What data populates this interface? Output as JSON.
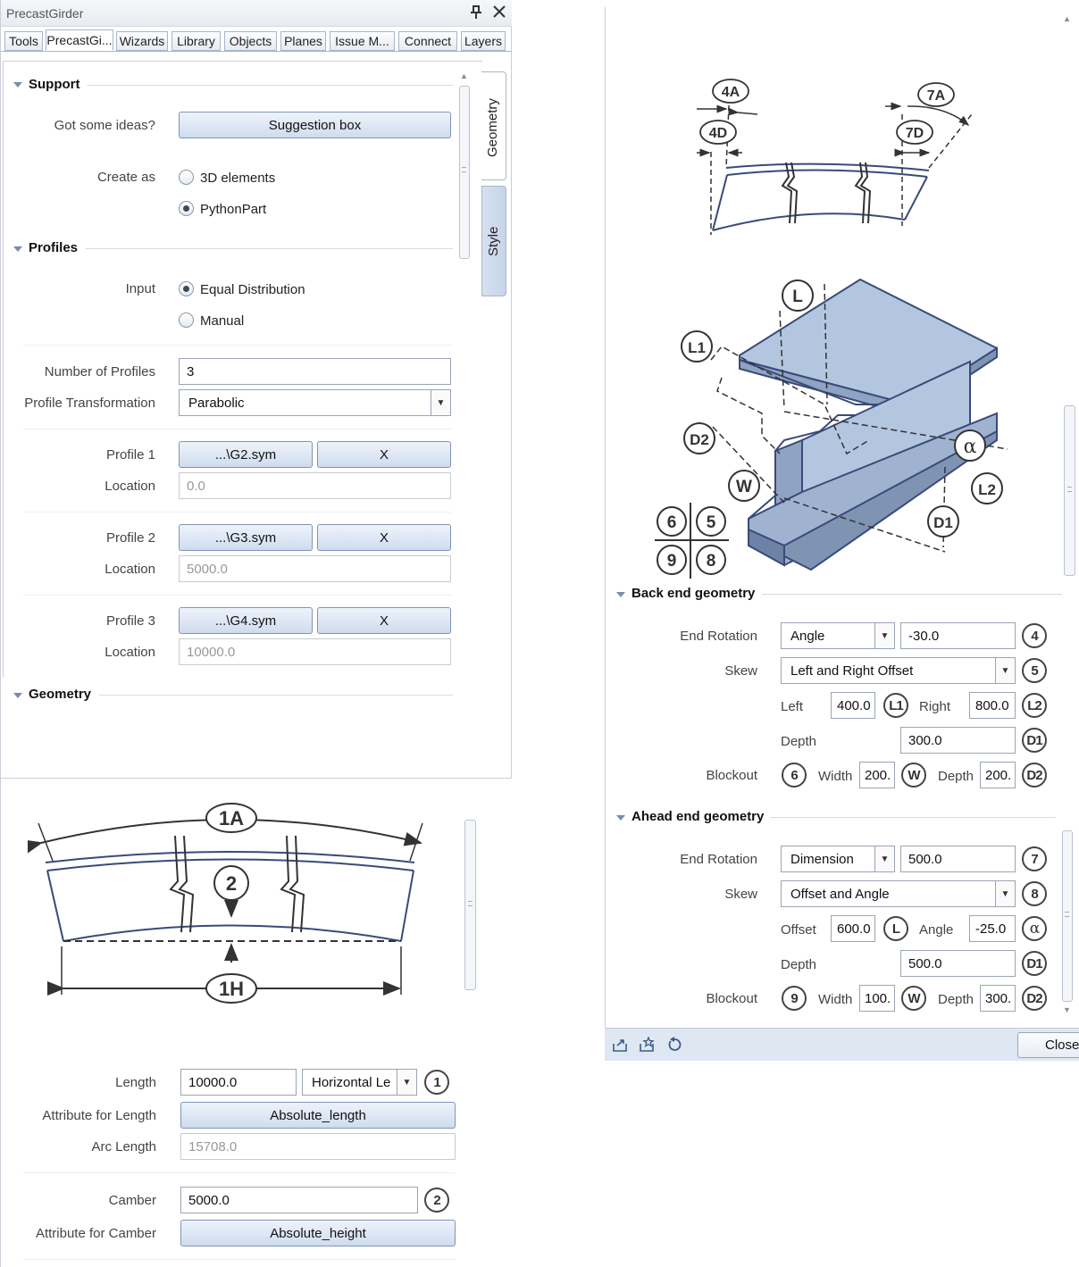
{
  "window": {
    "title": "PrecastGirder"
  },
  "tabs": [
    "Tools",
    "PrecastGi...",
    "Wizards",
    "Library",
    "Objects",
    "Planes",
    "Issue M...",
    "Connect",
    "Layers"
  ],
  "side_tabs": {
    "geometry": "Geometry",
    "style": "Style"
  },
  "support": {
    "header": "Support",
    "ideas_label": "Got some ideas?",
    "suggestion_button": "Suggestion box",
    "create_as_label": "Create as",
    "opt_3d": "3D elements",
    "opt_python": "PythonPart",
    "selected": "PythonPart"
  },
  "profiles": {
    "header": "Profiles",
    "input_label": "Input",
    "opt_equal": "Equal Distribution",
    "opt_manual": "Manual",
    "selected": "Equal Distribution",
    "num_label": "Number of Profiles",
    "num_value": "3",
    "transform_label": "Profile Transformation",
    "transform_value": "Parabolic",
    "items": [
      {
        "label": "Profile 1",
        "file": "...\\G2.sym",
        "clear": "X",
        "location_label": "Location",
        "location": "0.0"
      },
      {
        "label": "Profile 2",
        "file": "...\\G3.sym",
        "clear": "X",
        "location_label": "Location",
        "location": "5000.0"
      },
      {
        "label": "Profile 3",
        "file": "...\\G4.sym",
        "clear": "X",
        "location_label": "Location",
        "location": "10000.0"
      }
    ]
  },
  "geometry": {
    "header": "Geometry",
    "diagram_labels": {
      "arc": "1A",
      "camber": "2",
      "horizontal": "1H"
    },
    "length_label": "Length",
    "length_value": "10000.0",
    "length_type": "Horizontal Le",
    "length_marker": "1",
    "attr_length_label": "Attribute for Length",
    "attr_length_value": "Absolute_length",
    "arc_label": "Arc Length",
    "arc_value": "15708.0",
    "camber_label": "Camber",
    "camber_value": "5000.0",
    "camber_marker": "2",
    "attr_camber_label": "Attribute for Camber",
    "attr_camber_value": "Absolute_height"
  },
  "diagram_top": {
    "labels": {
      "a4": "4A",
      "d4": "4D",
      "a7": "7A",
      "d7": "7D"
    }
  },
  "diagram_iso": {
    "labels": {
      "L": "L",
      "L1": "L1",
      "D2": "D2",
      "W": "W",
      "alpha": "α",
      "L2": "L2",
      "D1": "D1",
      "n6": "6",
      "n5": "5",
      "n9": "9",
      "n8": "8"
    }
  },
  "back_end": {
    "header": "Back end geometry",
    "rotation_label": "End Rotation",
    "rotation_type": "Angle",
    "rotation_value": "-30.0",
    "rotation_marker": "4",
    "skew_label": "Skew",
    "skew_value": "Left and Right Offset",
    "skew_marker": "5",
    "left_label": "Left",
    "left_value": "400.0",
    "left_marker": "L1",
    "right_label": "Right",
    "right_value": "800.0",
    "right_marker": "L2",
    "depth_label": "Depth",
    "depth_value": "300.0",
    "depth_marker": "D1",
    "blockout_label": "Blockout",
    "blockout_marker": "6",
    "width_label": "Width",
    "width_value": "200.",
    "width_marker": "W",
    "bdepth_label": "Depth",
    "bdepth_value": "200.",
    "bdepth_marker": "D2"
  },
  "ahead_end": {
    "header": "Ahead end geometry",
    "rotation_label": "End Rotation",
    "rotation_type": "Dimension",
    "rotation_value": "500.0",
    "rotation_marker": "7",
    "skew_label": "Skew",
    "skew_value": "Offset and Angle",
    "skew_marker": "8",
    "offset_label": "Offset",
    "offset_value": "600.0",
    "offset_marker": "L",
    "angle_label": "Angle",
    "angle_value": "-25.0",
    "angle_marker": "α",
    "depth_label": "Depth",
    "depth_value": "500.0",
    "depth_marker": "D1",
    "blockout_label": "Blockout",
    "blockout_marker": "9",
    "width_label": "Width",
    "width_value": "100.",
    "width_marker": "W",
    "bdepth_label": "Depth",
    "bdepth_value": "300.",
    "bdepth_marker": "D2"
  },
  "footer": {
    "close": "Close"
  },
  "colors": {
    "accent": "#b9c9e0",
    "girder_fill": "#b3c6e0",
    "girder_dark": "#5f7190",
    "button_grad_top": "#eef3fb",
    "button_grad_bottom": "#cfdcee"
  }
}
